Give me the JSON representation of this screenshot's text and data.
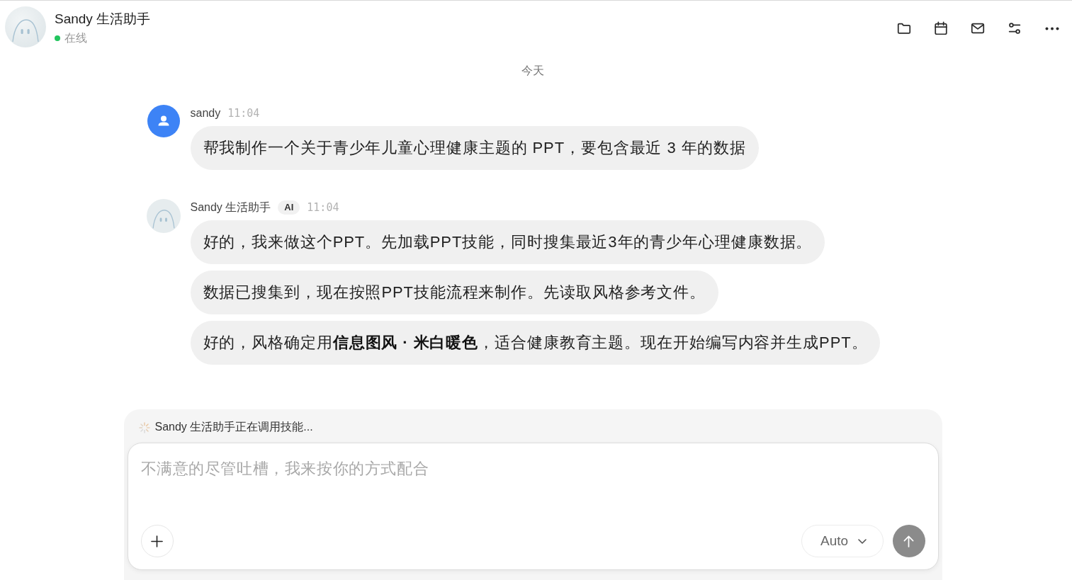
{
  "header": {
    "title": "Sandy 生活助手",
    "status": "在线",
    "online": true
  },
  "date_divider": "今天",
  "messages": [
    {
      "kind": "user",
      "author": "sandy",
      "time": "11:04",
      "bubbles": [
        "帮我制作一个关于青少年儿童心理健康主题的 PPT，要包含最近 3 年的数据"
      ]
    },
    {
      "kind": "assistant",
      "author": "Sandy 生活助手",
      "badge": "AI",
      "time": "11:04",
      "bubbles": [
        "好的，我来做这个PPT。先加载PPT技能，同时搜集最近3年的青少年心理健康数据。",
        "数据已搜集到，现在按照PPT技能流程来制作。先读取风格参考文件。",
        "好的，风格确定用**信息图风 · 米白暖色**，适合健康教育主题。现在开始编写内容并生成PPT。"
      ]
    }
  ],
  "composer": {
    "activity": "Sandy 生活助手正在调用技能...",
    "placeholder": "不满意的尽管吐槽，我来按你的方式配合",
    "mode": "Auto",
    "send_disabled": true
  }
}
